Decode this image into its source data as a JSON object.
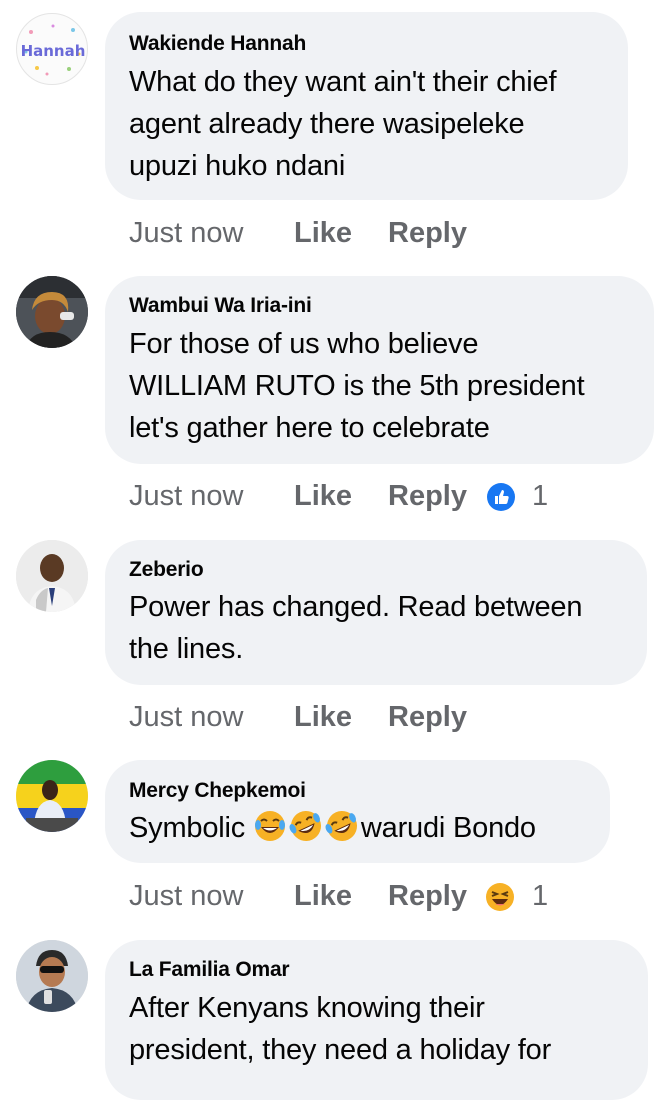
{
  "comments": [
    {
      "author": "Wakiende Hannah",
      "avatar_text": "Hannah",
      "lines": [
        "What do they want ain't their chief",
        "agent already there wasipeleke",
        "upuzi huko ndani"
      ],
      "time": "Just now",
      "like_label": "Like",
      "reply_label": "Reply",
      "reaction": null,
      "reaction_count": null
    },
    {
      "author": "Wambui Wa Iria-ini",
      "lines": [
        "For those of us who believe",
        "WILLIAM RUTO  is the 5th president",
        "let's gather here to celebrate"
      ],
      "time": "Just now",
      "like_label": "Like",
      "reply_label": "Reply",
      "reaction": "like-reaction-icon",
      "reaction_count": "1"
    },
    {
      "author": "Zeberio",
      "lines": [
        "Power has changed. Read between",
        "the lines."
      ],
      "time": "Just now",
      "like_label": "Like",
      "reply_label": "Reply",
      "reaction": null,
      "reaction_count": null
    },
    {
      "author": "Mercy Chepkemoi",
      "lines_prefix": "Symbolic ",
      "lines_suffix": "warudi Bondo",
      "inline_emojis": [
        "tears-of-joy-emoji",
        "rofl-emoji",
        "rofl-emoji"
      ],
      "time": "Just now",
      "like_label": "Like",
      "reply_label": "Reply",
      "reaction": "haha-reaction-icon",
      "reaction_count": "1"
    },
    {
      "author": "La Familia Omar",
      "lines": [
        "After Kenyans knowing their",
        "president, they need a holiday for"
      ],
      "time": null,
      "like_label": null,
      "reply_label": null,
      "reaction": null,
      "reaction_count": null
    }
  ],
  "colors": {
    "bubble_bg": "#f0f2f5",
    "secondary_text": "#65676b",
    "primary_text": "#050505",
    "like_blue": "#1877f2",
    "haha_yellow": "#f7b125"
  }
}
